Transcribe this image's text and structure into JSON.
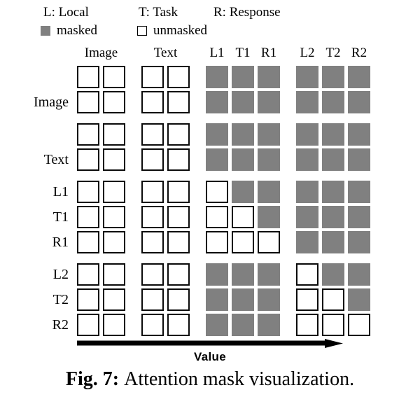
{
  "legend": {
    "abbreviations": [
      {
        "name": "local",
        "text": "L: Local"
      },
      {
        "name": "task",
        "text": "T: Task"
      },
      {
        "name": "response",
        "text": "R: Response"
      }
    ],
    "swatches": [
      {
        "name": "masked",
        "label": "masked",
        "state": "masked",
        "color": "#808080"
      },
      {
        "name": "unmasked",
        "label": "unmasked",
        "state": "unmasked",
        "color": "#ffffff"
      }
    ]
  },
  "matrix": {
    "column_headers": [
      {
        "label": "Image",
        "span_start": 0,
        "span_end": 1
      },
      {
        "label": "Text",
        "span_start": 2,
        "span_end": 3
      },
      {
        "label": "L1",
        "span_start": 4,
        "span_end": 4
      },
      {
        "label": "T1",
        "span_start": 5,
        "span_end": 5
      },
      {
        "label": "R1",
        "span_start": 6,
        "span_end": 6
      },
      {
        "label": "L2",
        "span_start": 7,
        "span_end": 7
      },
      {
        "label": "T2",
        "span_start": 8,
        "span_end": 8
      },
      {
        "label": "R2",
        "span_start": 9,
        "span_end": 9
      }
    ],
    "columns": [
      "Image",
      "Image",
      "Text",
      "Text",
      "L1",
      "T1",
      "R1",
      "L2",
      "T2",
      "R2"
    ],
    "rows": [
      {
        "label": "Image",
        "label_visible": false,
        "group_gap": false,
        "cells": [
          "unmasked",
          "unmasked",
          "unmasked",
          "unmasked",
          "masked",
          "masked",
          "masked",
          "masked",
          "masked",
          "masked"
        ]
      },
      {
        "label": "Image",
        "label_visible": true,
        "group_gap": false,
        "cells": [
          "unmasked",
          "unmasked",
          "unmasked",
          "unmasked",
          "masked",
          "masked",
          "masked",
          "masked",
          "masked",
          "masked"
        ]
      },
      {
        "label": "Text",
        "label_visible": false,
        "group_gap": true,
        "cells": [
          "unmasked",
          "unmasked",
          "unmasked",
          "unmasked",
          "masked",
          "masked",
          "masked",
          "masked",
          "masked",
          "masked"
        ]
      },
      {
        "label": "Text",
        "label_visible": true,
        "group_gap": false,
        "cells": [
          "unmasked",
          "unmasked",
          "unmasked",
          "unmasked",
          "masked",
          "masked",
          "masked",
          "masked",
          "masked",
          "masked"
        ]
      },
      {
        "label": "L1",
        "label_visible": true,
        "group_gap": true,
        "cells": [
          "unmasked",
          "unmasked",
          "unmasked",
          "unmasked",
          "unmasked",
          "masked",
          "masked",
          "masked",
          "masked",
          "masked"
        ]
      },
      {
        "label": "T1",
        "label_visible": true,
        "group_gap": false,
        "cells": [
          "unmasked",
          "unmasked",
          "unmasked",
          "unmasked",
          "unmasked",
          "unmasked",
          "masked",
          "masked",
          "masked",
          "masked"
        ]
      },
      {
        "label": "R1",
        "label_visible": true,
        "group_gap": false,
        "cells": [
          "unmasked",
          "unmasked",
          "unmasked",
          "unmasked",
          "unmasked",
          "unmasked",
          "unmasked",
          "masked",
          "masked",
          "masked"
        ]
      },
      {
        "label": "L2",
        "label_visible": true,
        "group_gap": true,
        "cells": [
          "unmasked",
          "unmasked",
          "unmasked",
          "unmasked",
          "masked",
          "masked",
          "masked",
          "unmasked",
          "masked",
          "masked"
        ]
      },
      {
        "label": "T2",
        "label_visible": true,
        "group_gap": false,
        "cells": [
          "unmasked",
          "unmasked",
          "unmasked",
          "unmasked",
          "masked",
          "masked",
          "masked",
          "unmasked",
          "unmasked",
          "masked"
        ]
      },
      {
        "label": "R2",
        "label_visible": true,
        "group_gap": false,
        "cells": [
          "unmasked",
          "unmasked",
          "unmasked",
          "unmasked",
          "masked",
          "masked",
          "masked",
          "unmasked",
          "unmasked",
          "unmasked"
        ]
      }
    ]
  },
  "axis": {
    "label": "Value",
    "direction": "right"
  },
  "caption": {
    "prefix": "Fig. 7:",
    "text": "Attention mask visualization."
  },
  "colors": {
    "masked": "#808080",
    "unmasked": "#ffffff",
    "outline": "#0a0a0a",
    "background": "#ffffff"
  }
}
